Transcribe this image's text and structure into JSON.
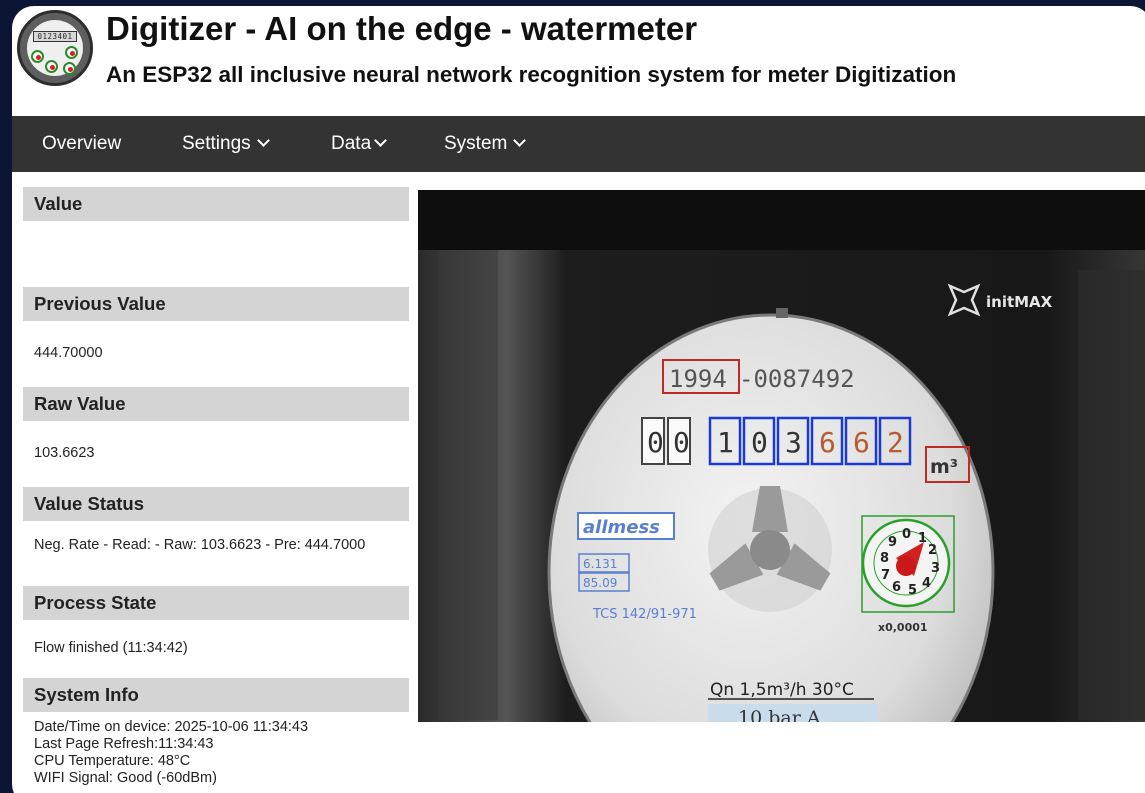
{
  "header": {
    "logo_digits": "0123401",
    "title": "Digitizer - AI on the edge - watermeter",
    "subtitle": "An ESP32 all inclusive neural network recognition system for meter Digitization"
  },
  "nav": {
    "items": [
      {
        "label": "Overview",
        "dropdown": false
      },
      {
        "label": "Settings",
        "dropdown": true
      },
      {
        "label": "Data",
        "dropdown": true
      },
      {
        "label": "System",
        "dropdown": true
      }
    ]
  },
  "sidebar": {
    "value": {
      "title": "Value",
      "text": ""
    },
    "previous_value": {
      "title": "Previous Value",
      "text": "444.70000"
    },
    "raw_value": {
      "title": "Raw Value",
      "text": "103.6623"
    },
    "value_status": {
      "title": "Value Status",
      "text": "Neg. Rate - Read: - Raw: 103.6623 - Pre: 444.7000"
    },
    "process_state": {
      "title": "Process State",
      "text": "Flow finished (11:34:42)"
    },
    "system_info": {
      "title": "System Info",
      "lines": [
        "Date/Time on device: 2025-10-06 11:34:43",
        "Last Page Refresh:11:34:43",
        "CPU Temperature: 48°C",
        "WIFI Signal: Good (-60dBm)"
      ]
    }
  },
  "camera": {
    "brand": "initMAX",
    "serial_prefix": "1994",
    "serial_suffix": "-0087492",
    "digits": [
      "0",
      "0",
      "1",
      "0",
      "3",
      "6",
      "6",
      "2"
    ],
    "unit": "m³",
    "maker": "allmess",
    "label1": "6.131",
    "label2": "85.09",
    "cert": "TCS 142/91-971",
    "multiplier": "x0,0001",
    "dial_numbers": [
      "0",
      "1",
      "2",
      "3",
      "4",
      "5",
      "6",
      "7",
      "8",
      "9"
    ],
    "flow": "Qn 1,5m³/h 30°C",
    "pressure": "10 bar A",
    "colors": {
      "roi_digit": "#1a3ad0",
      "roi_analog": "#2aa02a",
      "roi_info": "#c02a20"
    }
  }
}
